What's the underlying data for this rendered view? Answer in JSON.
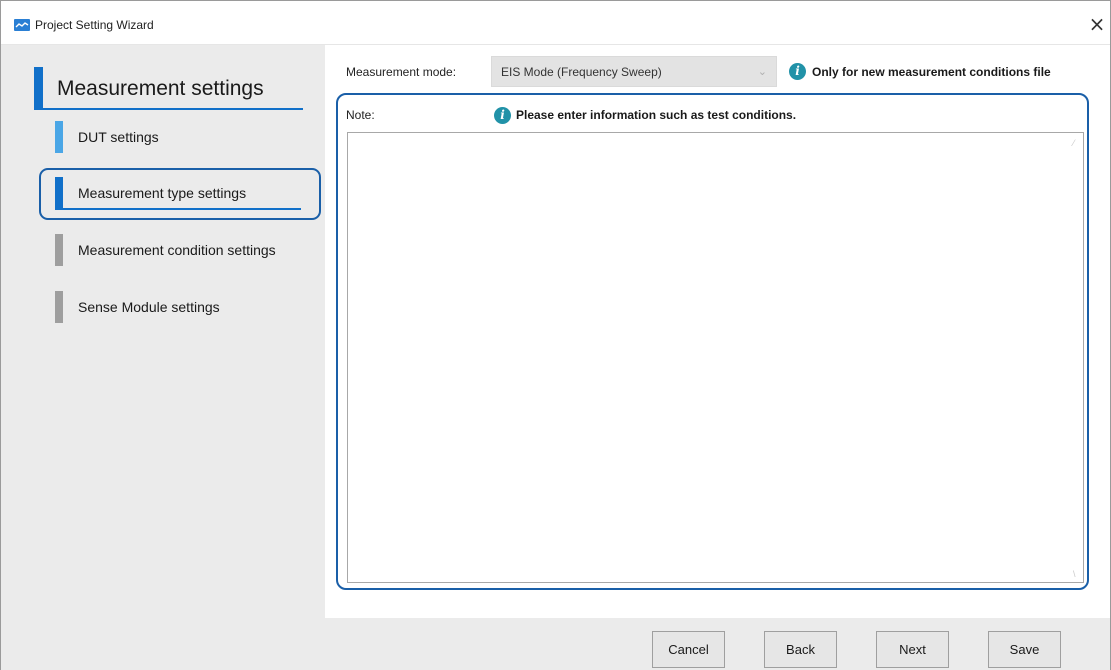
{
  "window": {
    "title": "Project Setting Wizard",
    "close_glyph": "×",
    "app_icon": "chart-line-icon"
  },
  "sidebar": {
    "heading": "Measurement settings",
    "items": [
      {
        "label": "DUT settings",
        "state": "done"
      },
      {
        "label": "Measurement type settings",
        "state": "active"
      },
      {
        "label": "Measurement condition settings",
        "state": "pending"
      },
      {
        "label": "Sense Module settings",
        "state": "pending"
      }
    ]
  },
  "main": {
    "mode_label": "Measurement mode:",
    "mode_value": "EIS Mode (Frequency Sweep)",
    "mode_chevron": "⌄",
    "mode_info": "Only for new measurement conditions file",
    "note_label": "Note:",
    "note_hint": "Please enter information such as test conditions.",
    "note_value": ""
  },
  "footer": {
    "cancel": "Cancel",
    "back": "Back",
    "next": "Next",
    "save": "Save"
  },
  "colors": {
    "accent": "#1170c9",
    "done": "#4aa6e6",
    "pending": "#9e9e9e",
    "info": "#2192a8",
    "highlight": "#1a5fa8"
  }
}
